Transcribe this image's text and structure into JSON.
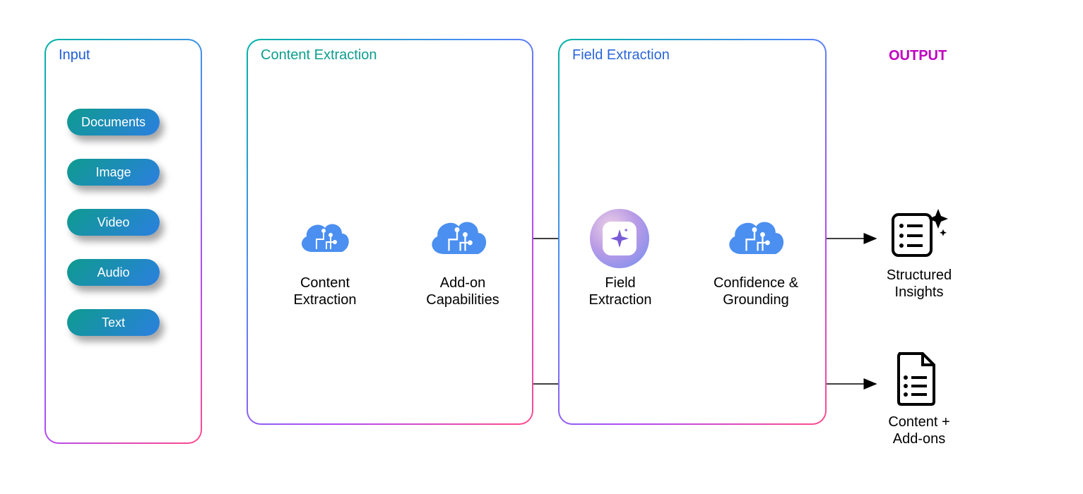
{
  "panels": {
    "input": {
      "title": "Input"
    },
    "content": {
      "title": "Content Extraction"
    },
    "field": {
      "title": "Field Extraction"
    }
  },
  "output_header": "OUTPUT",
  "input_pills": [
    "Documents",
    "Image",
    "Video",
    "Audio",
    "Text"
  ],
  "nodes": {
    "content_extraction": "Content\nExtraction",
    "addon": "Add-on\nCapabilities",
    "field_extraction": "Field\nExtraction",
    "confidence": "Confidence &\nGrounding",
    "structured": "Structured\nInsights",
    "content_addons": "Content +\nAdd-ons"
  }
}
